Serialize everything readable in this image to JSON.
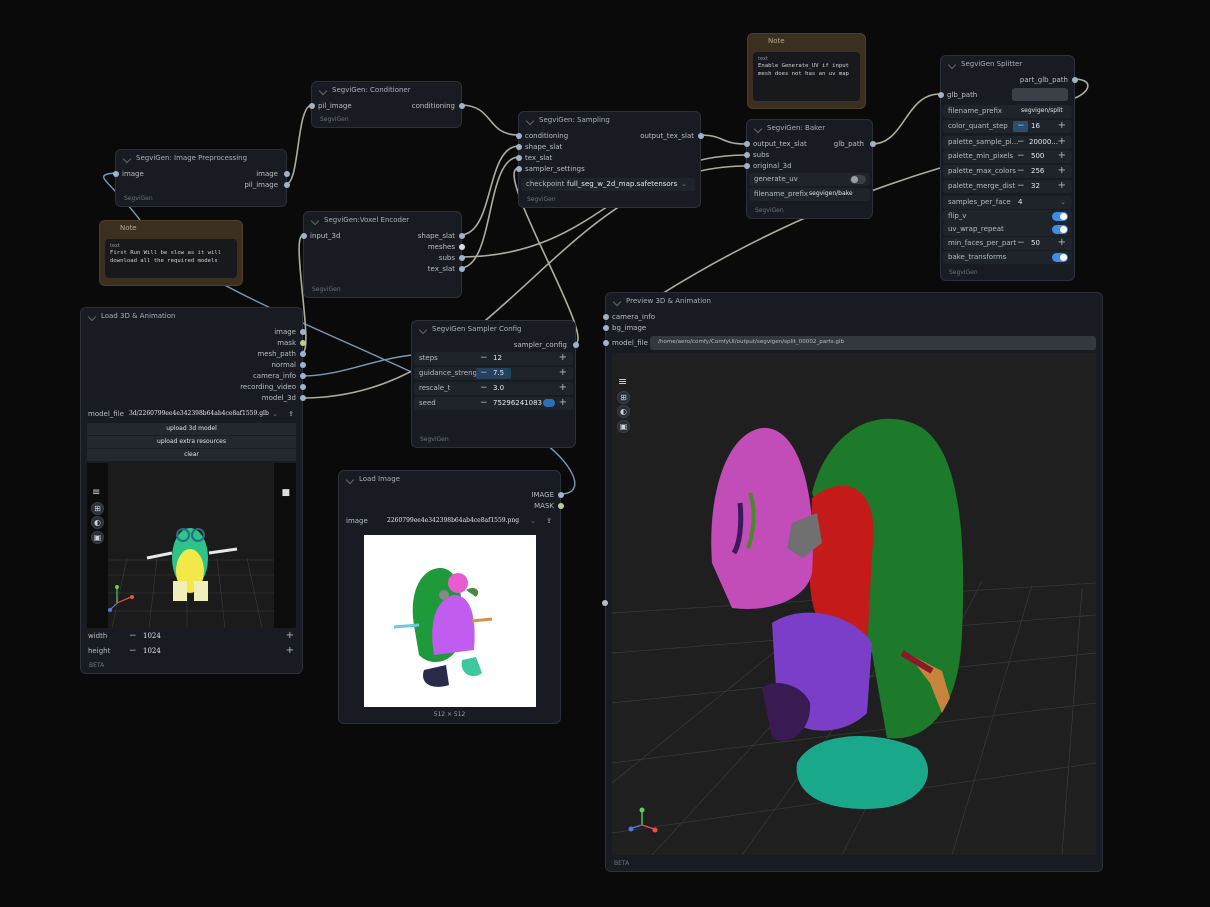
{
  "notes": {
    "note1": {
      "title": "Note",
      "label": "text",
      "text": "First Run Will be slow as it will download all the required models"
    },
    "note2": {
      "title": "Note",
      "label": "text",
      "text": "Enable Generate_UV if input mesh does not has an uv map"
    }
  },
  "image_preprocessing": {
    "title": "SegviGen: Image Preprocessing",
    "input": "image",
    "outputs": [
      "image",
      "pil_image"
    ],
    "footer": "SegviGen"
  },
  "conditioner": {
    "title": "SegviGen: Conditioner",
    "input": "pil_image",
    "output": "conditioning",
    "footer": "SegviGen"
  },
  "voxel_encoder": {
    "title": "SegviGen:Voxel Encoder",
    "input": "input_3d",
    "outputs": [
      "shape_slat",
      "meshes",
      "subs",
      "tex_slat"
    ],
    "footer": "SegviGen"
  },
  "sampling": {
    "title": "SegviGen: Sampling",
    "inputs": [
      "conditioning",
      "shape_slat",
      "tex_slat",
      "sampler_settings"
    ],
    "output": "output_tex_slat",
    "checkpoint_label": "checkpoint",
    "checkpoint_value": "full_seg_w_2d_map.safetensors",
    "footer": "SegviGen"
  },
  "baker": {
    "title": "SegviGen: Baker",
    "inputs": [
      "output_tex_slat",
      "subs",
      "original_3d"
    ],
    "output": "glb_path",
    "generate_uv_label": "generate_uv",
    "filename_prefix_label": "filename_prefix",
    "filename_prefix_value": "segvigen/bake",
    "footer": "SegviGen"
  },
  "splitter": {
    "title": "SegviGen Splitter",
    "output": "part_glb_path",
    "input": "glb_path",
    "filename_prefix_label": "filename_prefix",
    "filename_prefix_value": "segvigen/split",
    "widgets": [
      {
        "label": "color_quant_step",
        "value": "16"
      },
      {
        "label": "palette_sample_pi...",
        "value": "20000..."
      },
      {
        "label": "palette_min_pixels",
        "value": "500"
      },
      {
        "label": "palette_max_colors",
        "value": "256"
      },
      {
        "label": "palette_merge_dist",
        "value": "32"
      }
    ],
    "samples_label": "samples_per_face",
    "samples_value": "4",
    "toggles": [
      "flip_v",
      "uv_wrap_repeat"
    ],
    "min_faces_label": "min_faces_per_part",
    "min_faces_value": "50",
    "bake_label": "bake_transforms",
    "footer": "SegviGen"
  },
  "sampler_config": {
    "title": "SegviGen Sampler Config",
    "output": "sampler_config",
    "widgets": [
      {
        "label": "steps",
        "value": "12"
      },
      {
        "label": "guidance_strength",
        "value": "7.5"
      },
      {
        "label": "rescale_t",
        "value": "3.0"
      },
      {
        "label": "seed",
        "value": "75296241083 ..."
      }
    ],
    "footer": "SegviGen"
  },
  "load3d": {
    "title": "Load 3D & Animation",
    "outputs": [
      "image",
      "mask",
      "mesh_path",
      "normal",
      "camera_info",
      "recording_video",
      "model_3d"
    ],
    "model_file_label": "model_file",
    "model_file_value": "3d/2260799ee4e342398b64ab4ce8af1559.glb",
    "buttons": [
      "upload 3d model",
      "upload extra resources",
      "clear"
    ],
    "width_label": "width",
    "width_value": "1024",
    "height_label": "height",
    "height_value": "1024",
    "footer": "BETA"
  },
  "load_image": {
    "title": "Load Image",
    "outputs": [
      "IMAGE",
      "MASK"
    ],
    "image_label": "image",
    "image_value": "2260799ee4e342398b64ab4ce8af1559.png",
    "size": "512 × 512"
  },
  "preview3d": {
    "title": "Preview 3D & Animation",
    "inputs": [
      "camera_info",
      "bg_image"
    ],
    "model_file_label": "model_file",
    "model_file_value": "/home/aero/comfy/ComfyUI/output/segvigen/split_00002_parts.glb",
    "footer": "BETA"
  },
  "colors": {
    "canvas": "#0a0a0a",
    "node": "#181c22",
    "note": "#3b2f20",
    "toggle_on": "#3e8de8",
    "wire": "#c8c9b8"
  }
}
